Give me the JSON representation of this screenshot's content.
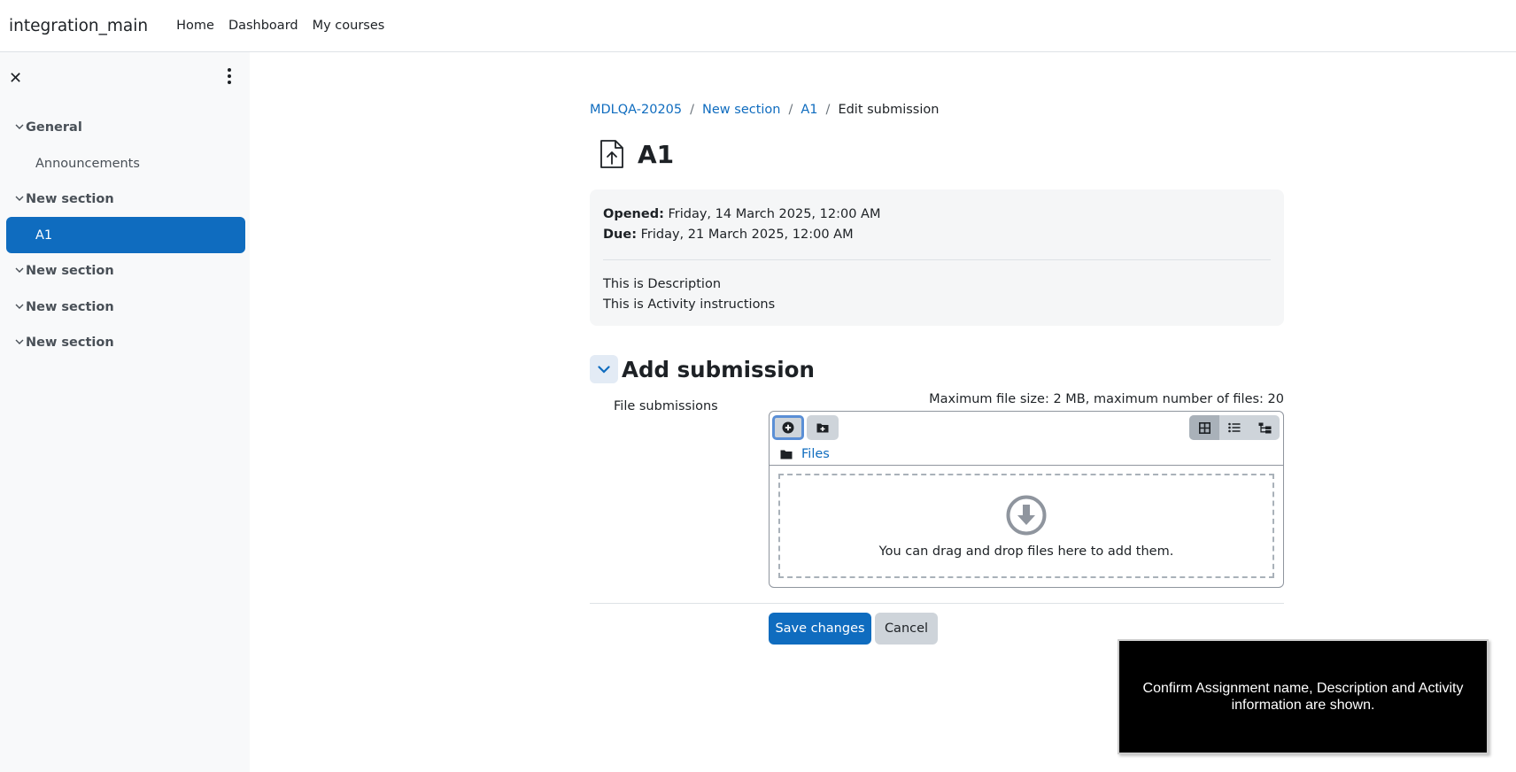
{
  "navbar": {
    "brand": "integration_main",
    "links": [
      "Home",
      "Dashboard",
      "My courses"
    ]
  },
  "drawer": {
    "items": [
      {
        "type": "section",
        "label": "General"
      },
      {
        "type": "activity",
        "label": "Announcements"
      },
      {
        "type": "section",
        "label": "New section"
      },
      {
        "type": "activity",
        "label": "A1",
        "active": true
      },
      {
        "type": "section",
        "label": "New section"
      },
      {
        "type": "section",
        "label": "New section"
      },
      {
        "type": "section",
        "label": "New section"
      }
    ]
  },
  "breadcrumb": {
    "items": [
      "MDLQA-20205",
      "New section",
      "A1"
    ],
    "current": "Edit submission"
  },
  "page": {
    "title": "A1",
    "opened_label": "Opened:",
    "opened_value": "Friday, 14 March 2025, 12:00 AM",
    "due_label": "Due:",
    "due_value": "Friday, 21 March 2025, 12:00 AM",
    "description": "This is Description",
    "instructions": "This is Activity instructions"
  },
  "submission": {
    "heading": "Add submission",
    "field_label": "File submissions",
    "limits": "Maximum file size: 2 MB, maximum number of files: 20",
    "path_label": "Files",
    "dropzone_text": "You can drag and drop files here to add them."
  },
  "buttons": {
    "save": "Save changes",
    "cancel": "Cancel"
  },
  "instruction": {
    "text": "Confirm Assignment name, Description and Activity information are shown."
  },
  "colors": {
    "primary": "#0f6cbf",
    "drawer_bg": "#f8f9fa",
    "info_bg": "#f5f6f7",
    "secondary_btn": "#ced4da"
  }
}
